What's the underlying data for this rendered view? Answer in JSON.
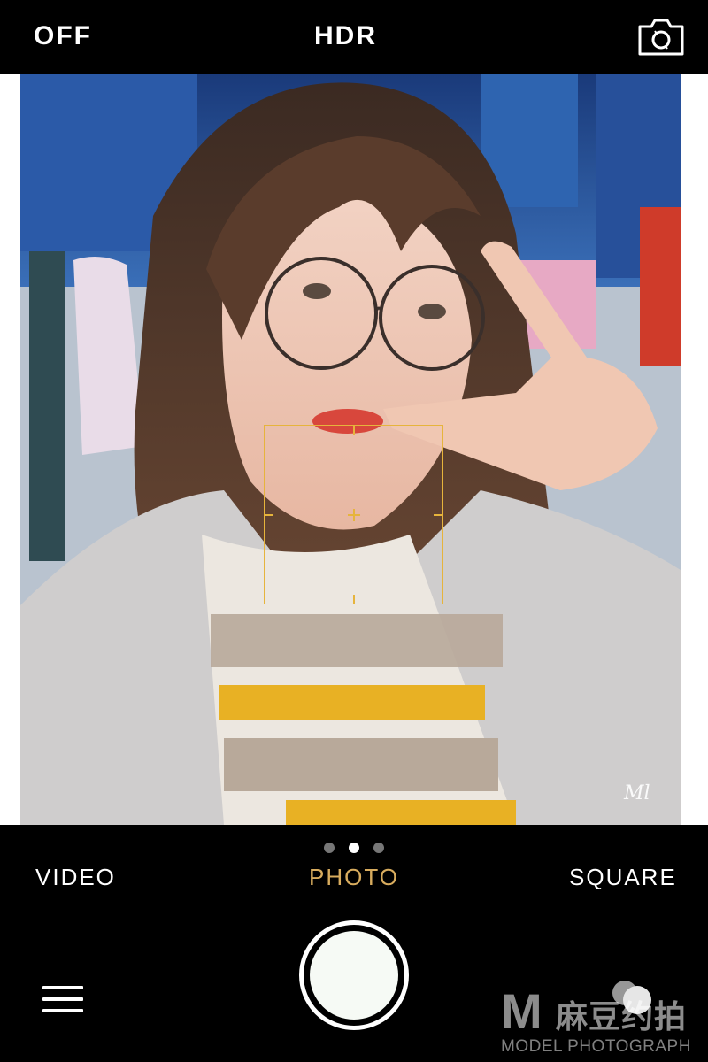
{
  "top_bar": {
    "flash_label": "OFF",
    "hdr_label": "HDR",
    "switch_camera_icon": "camera-switch-icon"
  },
  "viewfinder": {
    "signature_text": "Ml"
  },
  "mode_selector": {
    "page_count": 3,
    "active_page": 2,
    "modes": [
      "VIDEO",
      "PHOTO",
      "SQUARE"
    ],
    "active_mode": "PHOTO"
  },
  "bottom_bar": {
    "menu_icon": "hamburger-menu-icon",
    "shutter_icon": "shutter-button",
    "gallery_icon": "gallery-thumbnail-icon"
  },
  "watermark": {
    "logo": "M",
    "chinese": "麻豆约拍",
    "english": "MODEL PHOTOGRAPH"
  },
  "colors": {
    "accent": "#d8ac5e",
    "focus_box": "#e6b43c",
    "background": "#000000",
    "text": "#ffffff"
  }
}
